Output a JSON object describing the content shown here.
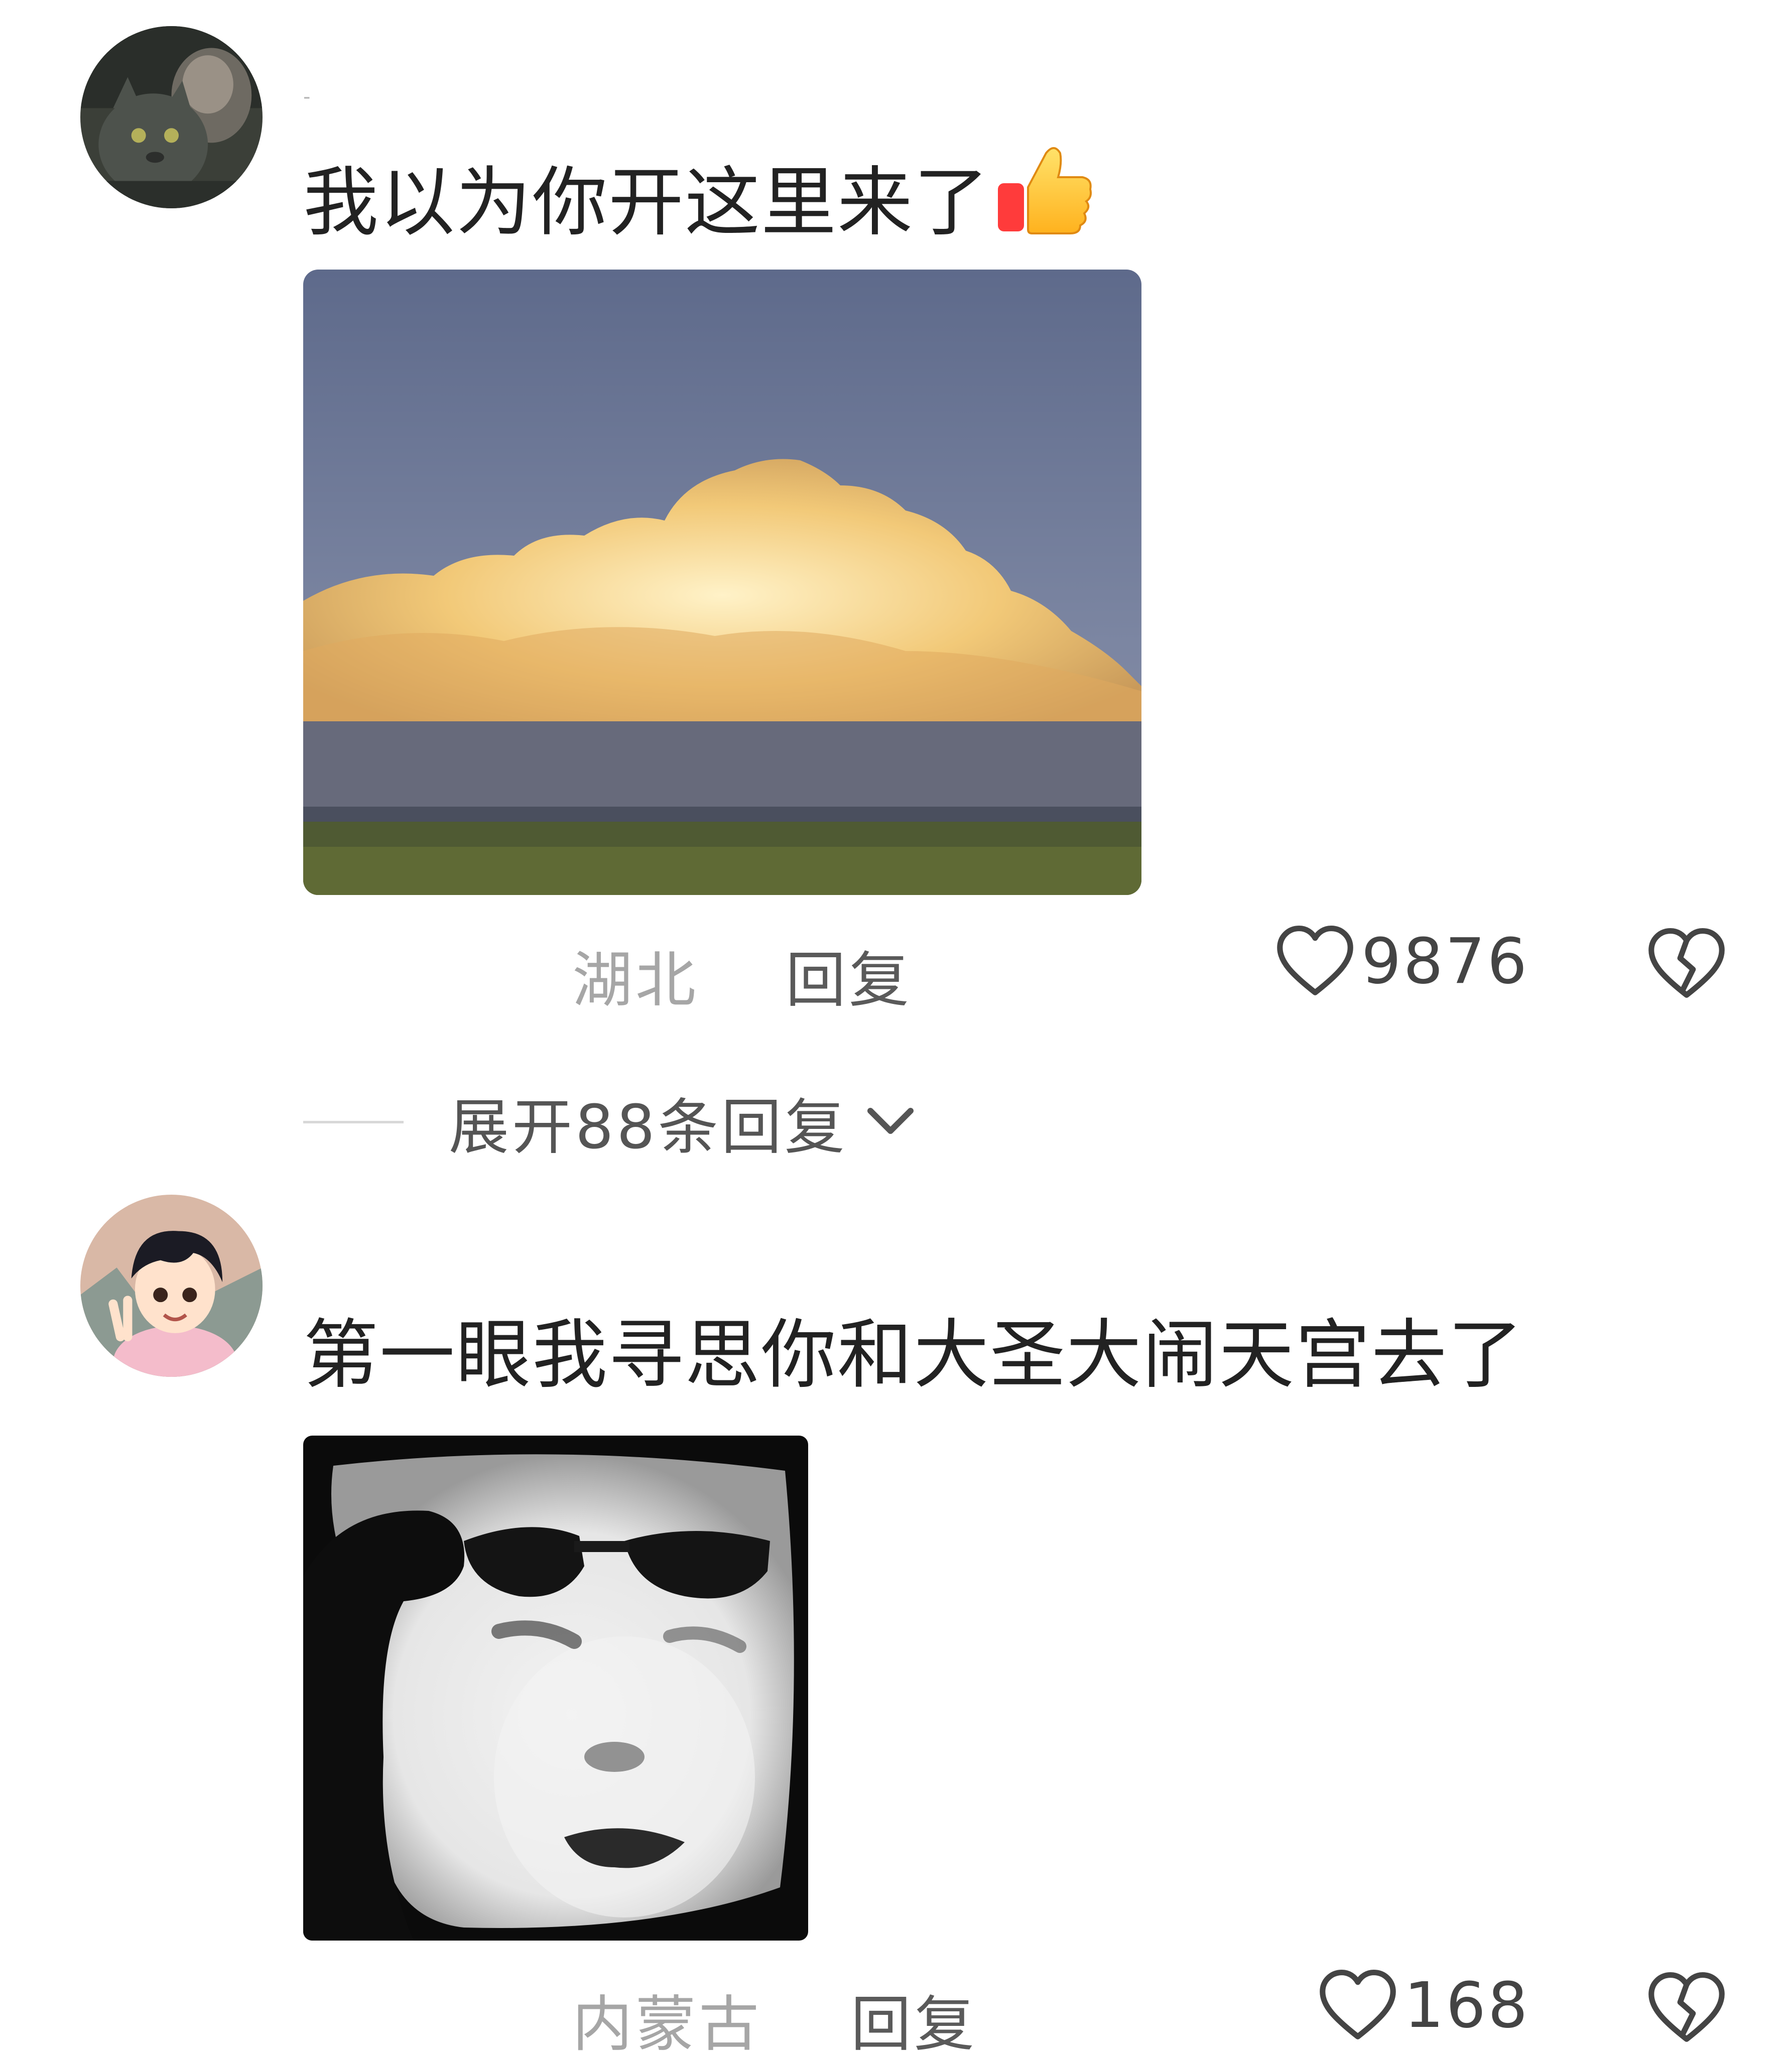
{
  "comments": [
    {
      "username": "-",
      "text": "我以为你开这里来了",
      "emoji": "thumbs-up-emoji",
      "image": "sunset-cumulus-cloud-over-field",
      "location": "湖北",
      "reply_label": "回复",
      "like_count": "9876",
      "expand_label": "展开88条回复"
    },
    {
      "username": "",
      "text": "第一眼我寻思你和大圣大闹天宫去了",
      "image": "salute-sunglasses-meme-face",
      "location": "内蒙古",
      "reply_label": "回复",
      "like_count": "168"
    }
  ],
  "icons": {
    "like": "heart-outline-icon",
    "dislike": "broken-heart-icon",
    "expand": "chevron-down-icon"
  },
  "colors": {
    "text": "#222222",
    "meta": "#a6a6a6",
    "reply": "#5a5a5a"
  }
}
